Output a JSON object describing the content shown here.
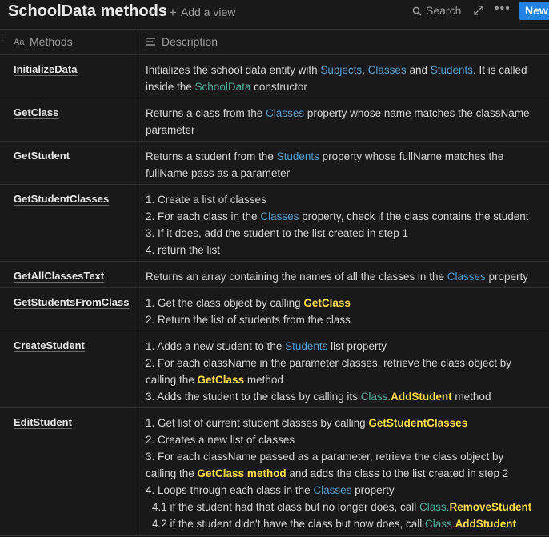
{
  "header": {
    "title": "SchoolData methods",
    "add_view": "Add a view",
    "search": "Search",
    "new_button": "New"
  },
  "columns": {
    "methods": "Methods",
    "description": "Description"
  },
  "rows": [
    {
      "method": "InitializeData",
      "lines": [
        [
          [
            "Initializes the school data entity with ",
            ""
          ],
          [
            "Subjects",
            "b"
          ],
          [
            ", ",
            ""
          ],
          [
            "Classes",
            "b"
          ],
          [
            " and ",
            ""
          ],
          [
            "Students",
            "b"
          ],
          [
            ". It is called",
            ""
          ]
        ],
        [
          [
            "inside the ",
            ""
          ],
          [
            "SchoolData",
            "t"
          ],
          [
            " constructor",
            ""
          ]
        ]
      ]
    },
    {
      "method": "GetClass",
      "lines": [
        [
          [
            "Returns a class from the ",
            ""
          ],
          [
            "Classes",
            "b"
          ],
          [
            " property whose name matches the className",
            ""
          ]
        ],
        [
          [
            "parameter",
            ""
          ]
        ]
      ]
    },
    {
      "method": "GetStudent",
      "lines": [
        [
          [
            "Returns a student from the ",
            ""
          ],
          [
            "Students",
            "b"
          ],
          [
            " property whose fullName matches the",
            ""
          ]
        ],
        [
          [
            "fullName pass as a parameter",
            ""
          ]
        ]
      ]
    },
    {
      "method": "GetStudentClasses",
      "lines": [
        [
          [
            "1. Create a list of classes",
            ""
          ]
        ],
        [
          [
            "2. For each class in the ",
            ""
          ],
          [
            "Classes",
            "b"
          ],
          [
            " property, check if the class contains the student",
            ""
          ]
        ],
        [
          [
            "3. If it does, add the student to the list created in step 1",
            ""
          ]
        ],
        [
          [
            "4. return the list",
            ""
          ]
        ]
      ]
    },
    {
      "method": "GetAllClassesText",
      "lines": [
        [
          [
            "Returns an array containing the names of all the classes in the ",
            ""
          ],
          [
            "Classes",
            "b"
          ],
          [
            " property",
            ""
          ]
        ]
      ]
    },
    {
      "method": "GetStudentsFromClass",
      "lines": [
        [
          [
            "1. Get the class object by calling ",
            ""
          ],
          [
            "GetClass",
            "y"
          ]
        ],
        [
          [
            "2. Return the list of students from the class",
            ""
          ]
        ]
      ]
    },
    {
      "method": "CreateStudent",
      "lines": [
        [
          [
            "1. Adds a new student to the ",
            ""
          ],
          [
            "Students",
            "b"
          ],
          [
            " list property",
            ""
          ]
        ],
        [
          [
            "2. For each className in the parameter classes, retrieve the class object by",
            ""
          ]
        ],
        [
          [
            "calling the ",
            ""
          ],
          [
            "GetClass",
            "y"
          ],
          [
            " method",
            ""
          ]
        ],
        [
          [
            "3. Adds the student to the class by calling its ",
            ""
          ],
          [
            "Class.",
            "t"
          ],
          [
            "AddStudent",
            "y"
          ],
          [
            " method",
            ""
          ]
        ]
      ]
    },
    {
      "method": "EditStudent",
      "lines": [
        [
          [
            "1. Get list of current student classes by calling ",
            ""
          ],
          [
            "GetStudentClasses",
            "y"
          ]
        ],
        [
          [
            "2. Creates a new list of classes",
            ""
          ]
        ],
        [
          [
            "3.  For each className passed as a parameter, retrieve the class object by",
            ""
          ]
        ],
        [
          [
            "calling the ",
            ""
          ],
          [
            "GetClass method",
            "y"
          ],
          [
            " and adds the class to the list created in step 2",
            ""
          ]
        ],
        [
          [
            "4. Loops through each class in the ",
            ""
          ],
          [
            "Classes",
            "b"
          ],
          [
            " property",
            ""
          ]
        ],
        [
          [
            "4.1 if the student had that class but no longer does, call ",
            "ind"
          ],
          [
            "Class.",
            "t"
          ],
          [
            "RemoveStudent",
            "y"
          ]
        ],
        [
          [
            "4.2 if the student didn't have the class but now does, call ",
            "ind"
          ],
          [
            "Class.",
            "t"
          ],
          [
            "AddStudent",
            "y"
          ]
        ]
      ]
    }
  ]
}
